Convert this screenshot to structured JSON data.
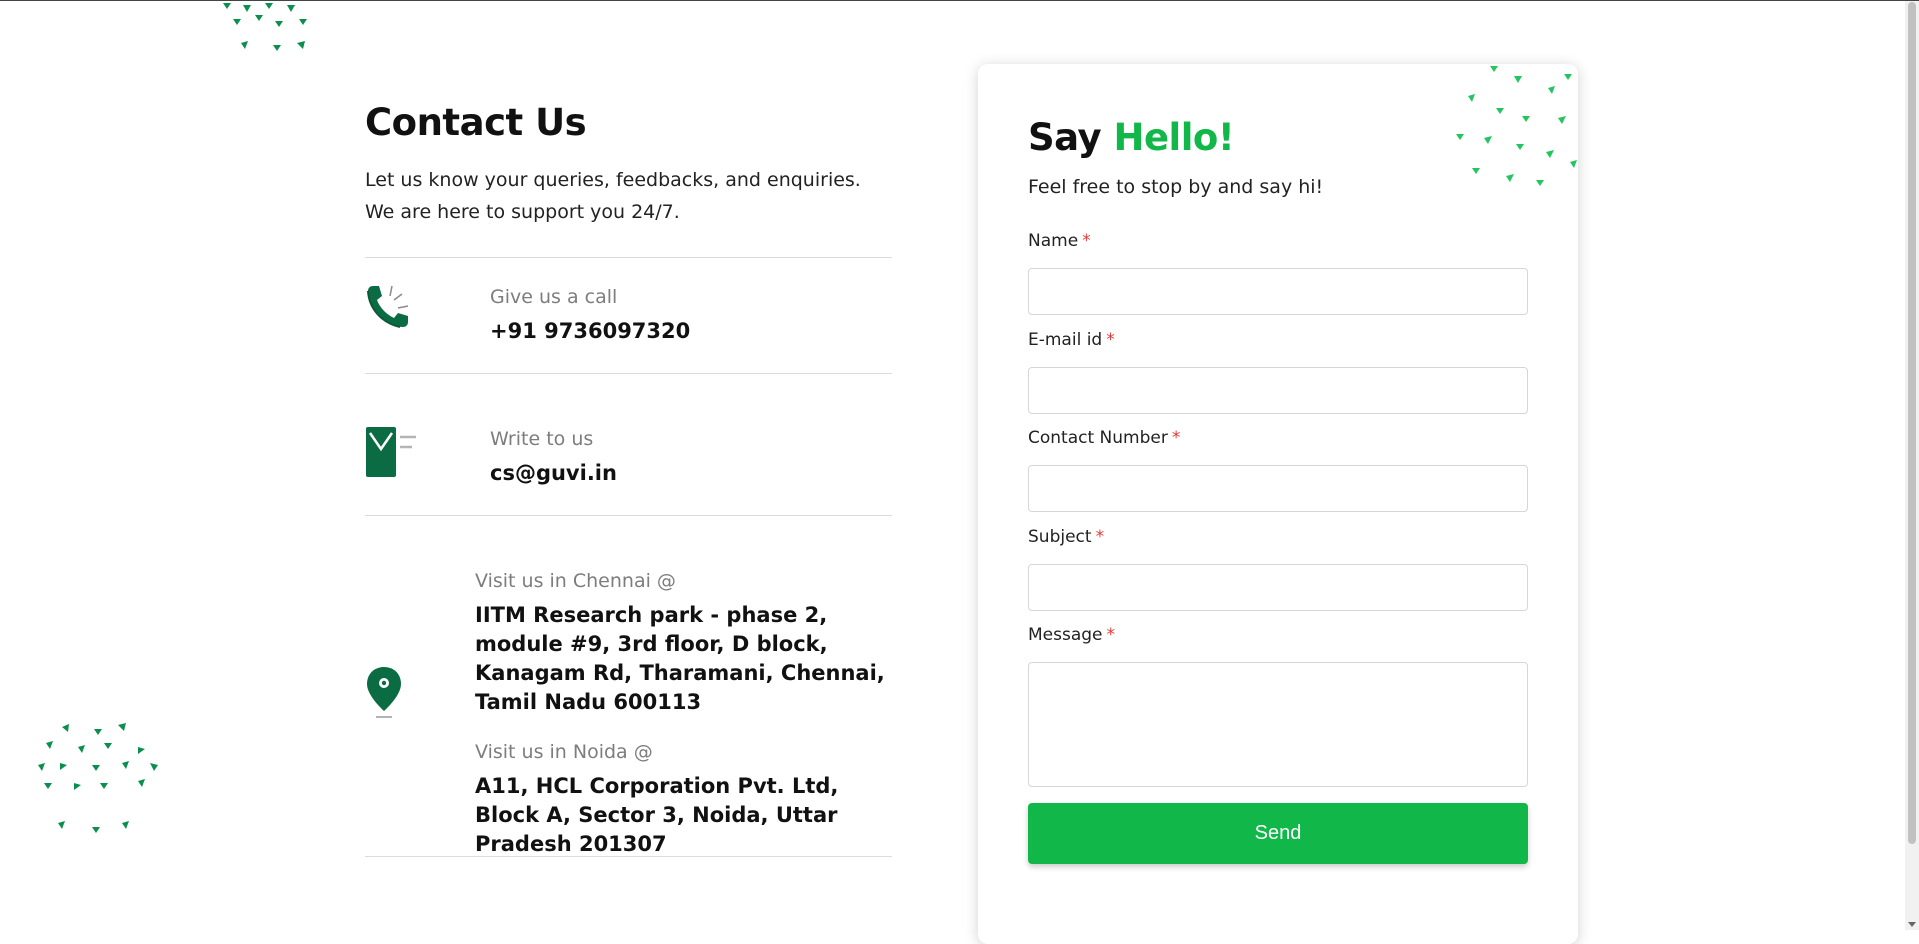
{
  "contact": {
    "title": "Contact Us",
    "intro": "Let us know your queries, feedbacks, and enquiries. We are here to support you 24/7.",
    "call": {
      "label": "Give us a call",
      "value": "+91 9736097320",
      "icon": "phone-icon"
    },
    "write": {
      "label": "Write to us",
      "value": "cs@guvi.in",
      "icon": "mail-icon"
    },
    "chennai": {
      "label": "Visit us in Chennai @",
      "address": "IITM Research park - phase 2, module #9, 3rd floor, D block, Kanagam Rd, Tharamani, Chennai, Tamil Nadu 600113"
    },
    "noida": {
      "label": "Visit us in Noida @",
      "address": "A11, HCL Corporation Pvt. Ltd, Block A, Sector 3, Noida, Uttar Pradesh 201307"
    },
    "location_icon": "location-pin-icon"
  },
  "form": {
    "title_prefix": "Say",
    "title_highlight": "Hello!",
    "subtitle": "Feel free to stop by and say hi!",
    "required_mark": "*",
    "fields": {
      "name": {
        "label": "Name",
        "value": ""
      },
      "email": {
        "label": "E-mail id",
        "value": ""
      },
      "phone": {
        "label": "Contact Number",
        "value": ""
      },
      "subject": {
        "label": "Subject",
        "value": ""
      },
      "message": {
        "label": "Message",
        "value": ""
      }
    },
    "submit_label": "Send"
  },
  "colors": {
    "accent": "#11b849",
    "dark_green": "#0b6b42",
    "required": "#e53935",
    "muted_text": "#7d7d7d"
  }
}
